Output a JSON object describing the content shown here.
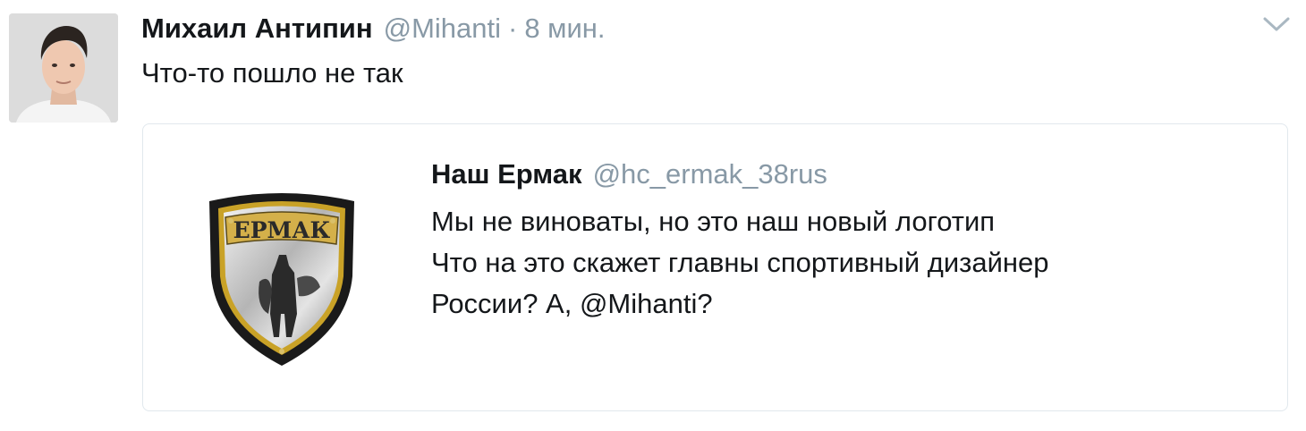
{
  "tweet": {
    "author": {
      "fullname": "Михаил Антипин",
      "username": "@Mihanti"
    },
    "separator": "·",
    "time": "8 мин.",
    "text": "Что-то пошло не так",
    "menu_icon": "chevron-down-icon"
  },
  "quoted_tweet": {
    "author": {
      "fullname": "Наш Ермак",
      "username": "@hc_ermak_38rus"
    },
    "text_lines": [
      "Мы не виноваты, но это наш новый логотип",
      "Что на это скажет главны спортивный дизайнер",
      "России? А, @Mihanti?"
    ],
    "logo": {
      "text": "ЕРМАК",
      "colors": {
        "outer": "#1a1a1a",
        "rim": "#c9a227",
        "fill": "#b8b8b8",
        "banner": "#d4b04a"
      }
    }
  },
  "colors": {
    "text_primary": "#14171a",
    "text_secondary": "#8899a6",
    "border": "#e1e8ed"
  }
}
